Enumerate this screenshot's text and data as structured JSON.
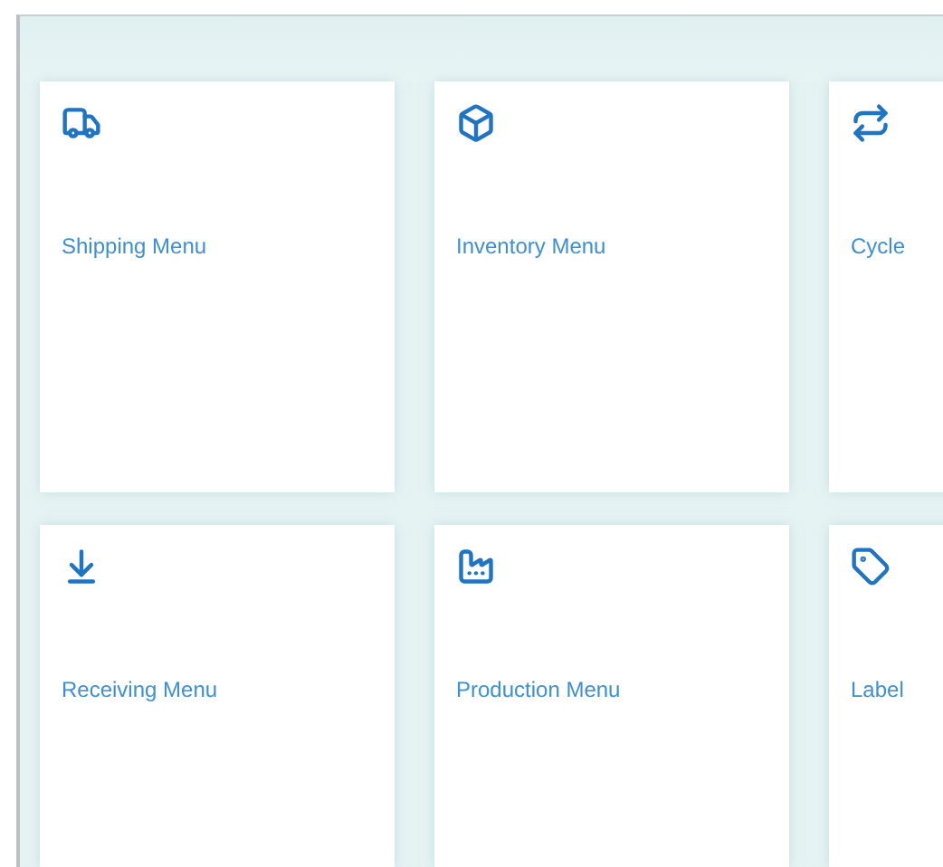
{
  "menu_tiles": [
    {
      "label": "Shipping Menu"
    },
    {
      "label": "Inventory Menu"
    },
    {
      "label": "Cycle"
    },
    {
      "label": "Receiving Menu"
    },
    {
      "label": "Production Menu"
    },
    {
      "label": "Label"
    }
  ]
}
